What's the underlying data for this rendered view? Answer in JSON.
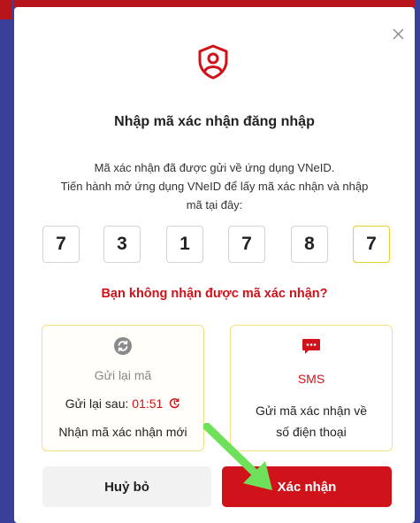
{
  "dialog": {
    "title": "Nhập mã xác nhận đăng nhập",
    "description_lines": [
      "Mã xác nhận đã được gửi về ứng dụng VNeID.",
      "Tiến hành mở ứng dụng VNeID để lấy mã xác nhận và nhập",
      "mã tại đây:"
    ],
    "otp_digits": [
      "7",
      "3",
      "1",
      "7",
      "8",
      "7"
    ],
    "not_received_link": "Bạn không nhận được mã xác nhận?",
    "options": {
      "resend": {
        "label": "Gửi lại mã",
        "after_prefix": "Gửi lại sau: ",
        "countdown": "01:51",
        "description": "Nhận mã xác nhận mới",
        "icon": "refresh-icon"
      },
      "sms": {
        "label": "SMS",
        "description_lines": [
          "Gửi mã xác nhận về",
          "số điện thoại"
        ],
        "icon": "sms-icon"
      }
    },
    "buttons": {
      "cancel": "Huỷ bỏ",
      "confirm": "Xác nhận"
    }
  },
  "colors": {
    "brand_red": "#d0121b",
    "card_border": "#efe184",
    "arrow_green": "#6ee05a"
  }
}
